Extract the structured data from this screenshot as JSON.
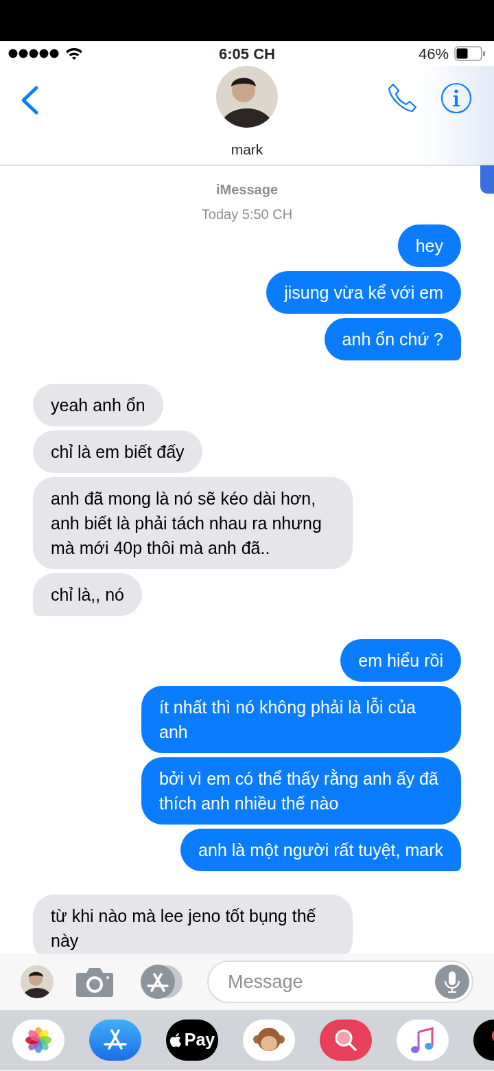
{
  "status_bar": {
    "time": "6:05 CH",
    "battery": "46%"
  },
  "header": {
    "contact_name": "mark"
  },
  "conversation": {
    "service": "iMessage",
    "timestamp": "Today 5:50 CH",
    "messages": [
      {
        "kind": "sent",
        "text": "hey",
        "tail": false
      },
      {
        "kind": "sent",
        "text": "jisung vừa kể với em",
        "tail": false
      },
      {
        "kind": "sent",
        "text": "anh ổn chứ ?",
        "tail": true
      },
      {
        "kind": "received",
        "text": "yeah anh ổn",
        "tail": false
      },
      {
        "kind": "received",
        "text": "chỉ là em biết đấy",
        "tail": false
      },
      {
        "kind": "received",
        "text": "anh đã mong là nó sẽ kéo dài hơn, anh biết là phải tách nhau ra nhưng mà mới 40p thôi mà anh đã..",
        "tail": false
      },
      {
        "kind": "received",
        "text": "chỉ là,, nó",
        "tail": true
      },
      {
        "kind": "sent",
        "text": "em hiểu rồi",
        "tail": false
      },
      {
        "kind": "sent",
        "text": "ít nhất thì nó không phải là lỗi của anh",
        "tail": false
      },
      {
        "kind": "sent",
        "text": "bởi vì em có thể thấy rằng anh ấy đã thích anh nhiều thế nào",
        "tail": false
      },
      {
        "kind": "sent",
        "text": "anh là một người rất tuyệt, mark",
        "tail": true
      },
      {
        "kind": "received",
        "text": "từ khi nào mà lee jeno tốt bụng thế này",
        "tail": false
      }
    ]
  },
  "composer": {
    "placeholder": "Message"
  },
  "app_drawer": [
    {
      "kind": "photos"
    },
    {
      "kind": "app_store"
    },
    {
      "kind": "apple_pay",
      "label": "Pay"
    },
    {
      "kind": "animoji"
    },
    {
      "kind": "web_search"
    },
    {
      "kind": "music"
    },
    {
      "kind": "hearts"
    }
  ]
}
